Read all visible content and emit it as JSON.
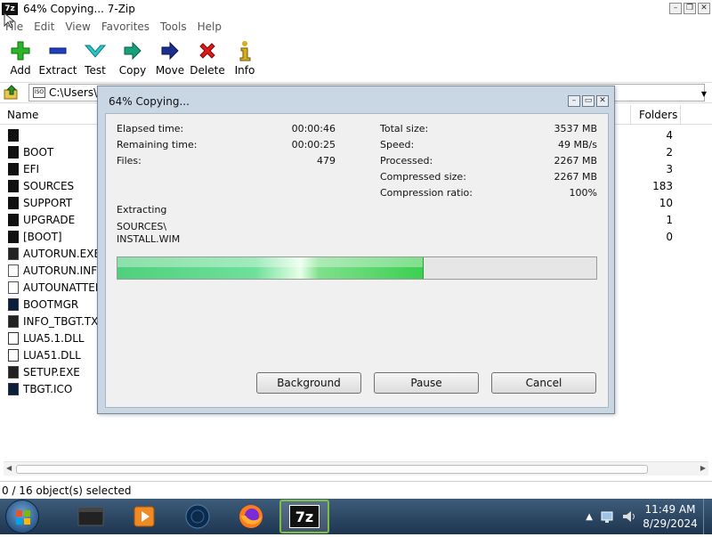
{
  "window": {
    "title": "64% Copying... 7-Zip",
    "logo": "7z"
  },
  "menu": [
    "File",
    "Edit",
    "View",
    "Favorites",
    "Tools",
    "Help"
  ],
  "toolbar": [
    {
      "label": "Add",
      "icon": "plus-icon",
      "color": "#22a822"
    },
    {
      "label": "Extract",
      "icon": "minus-icon",
      "color": "#1a2fa8"
    },
    {
      "label": "Test",
      "icon": "check-icon",
      "color": "#19b6b8"
    },
    {
      "label": "Copy",
      "icon": "arrow-right-icon",
      "color": "#159a7a"
    },
    {
      "label": "Move",
      "icon": "arrow-right-icon",
      "color": "#1a2f8a"
    },
    {
      "label": "Delete",
      "icon": "x-icon",
      "color": "#d11a1a"
    },
    {
      "label": "Info",
      "icon": "info-icon",
      "color": "#c9a21a"
    }
  ],
  "address": {
    "path": "C:\\Users\\"
  },
  "columns": {
    "name": "Name",
    "folders": "Folders"
  },
  "files": [
    {
      "name": "",
      "type": "folder",
      "folders": "4"
    },
    {
      "name": "BOOT",
      "type": "folder",
      "folders": "2"
    },
    {
      "name": "EFI",
      "type": "folder",
      "folders": "3"
    },
    {
      "name": "SOURCES",
      "type": "folder",
      "folders": "183"
    },
    {
      "name": "SUPPORT",
      "type": "folder",
      "folders": "10"
    },
    {
      "name": "UPGRADE",
      "type": "folder",
      "folders": "1"
    },
    {
      "name": "[BOOT]",
      "type": "folder",
      "folders": "0"
    },
    {
      "name": "AUTORUN.EXE",
      "type": "exe",
      "folders": ""
    },
    {
      "name": "AUTORUN.INF",
      "type": "inf",
      "folders": ""
    },
    {
      "name": "AUTOUNATTEN",
      "type": "inf",
      "folders": ""
    },
    {
      "name": "BOOTMGR",
      "type": "img",
      "folders": ""
    },
    {
      "name": "INFO_TBGT.TXT",
      "type": "exe",
      "folders": ""
    },
    {
      "name": "LUA5.1.DLL",
      "type": "dll",
      "folders": ""
    },
    {
      "name": "LUA51.DLL",
      "type": "dll",
      "folders": ""
    },
    {
      "name": "SETUP.EXE",
      "type": "exe",
      "folders": ""
    },
    {
      "name": "TBGT.ICO",
      "type": "img",
      "folders": ""
    }
  ],
  "status": {
    "selected": "0 / 16 object(s) selected"
  },
  "taskbar": {
    "time": "11:49 AM",
    "date": "8/29/2024",
    "apps": [
      "file-manager-icon",
      "media-player-icon",
      "globe-icon",
      "firefox-icon",
      "7zip-icon"
    ],
    "active_app_label": "7z"
  },
  "dialog": {
    "title": "64% Copying...",
    "left_stats": [
      {
        "label": "Elapsed time:",
        "value": "00:00:46"
      },
      {
        "label": "Remaining time:",
        "value": "00:00:25"
      },
      {
        "label": "Files:",
        "value": "479"
      }
    ],
    "right_stats": [
      {
        "label": "Total size:",
        "value": "3537 MB"
      },
      {
        "label": "Speed:",
        "value": "49 MB/s"
      },
      {
        "label": "Processed:",
        "value": "2267 MB"
      },
      {
        "label": "Compressed size:",
        "value": "2267 MB"
      },
      {
        "label": "Compression ratio:",
        "value": "100%"
      }
    ],
    "operation": "Extracting",
    "current_path": "SOURCES\\",
    "current_file": "INSTALL.WIM",
    "progress_percent": 64,
    "buttons": {
      "background": "Background",
      "pause": "Pause",
      "cancel": "Cancel"
    }
  }
}
